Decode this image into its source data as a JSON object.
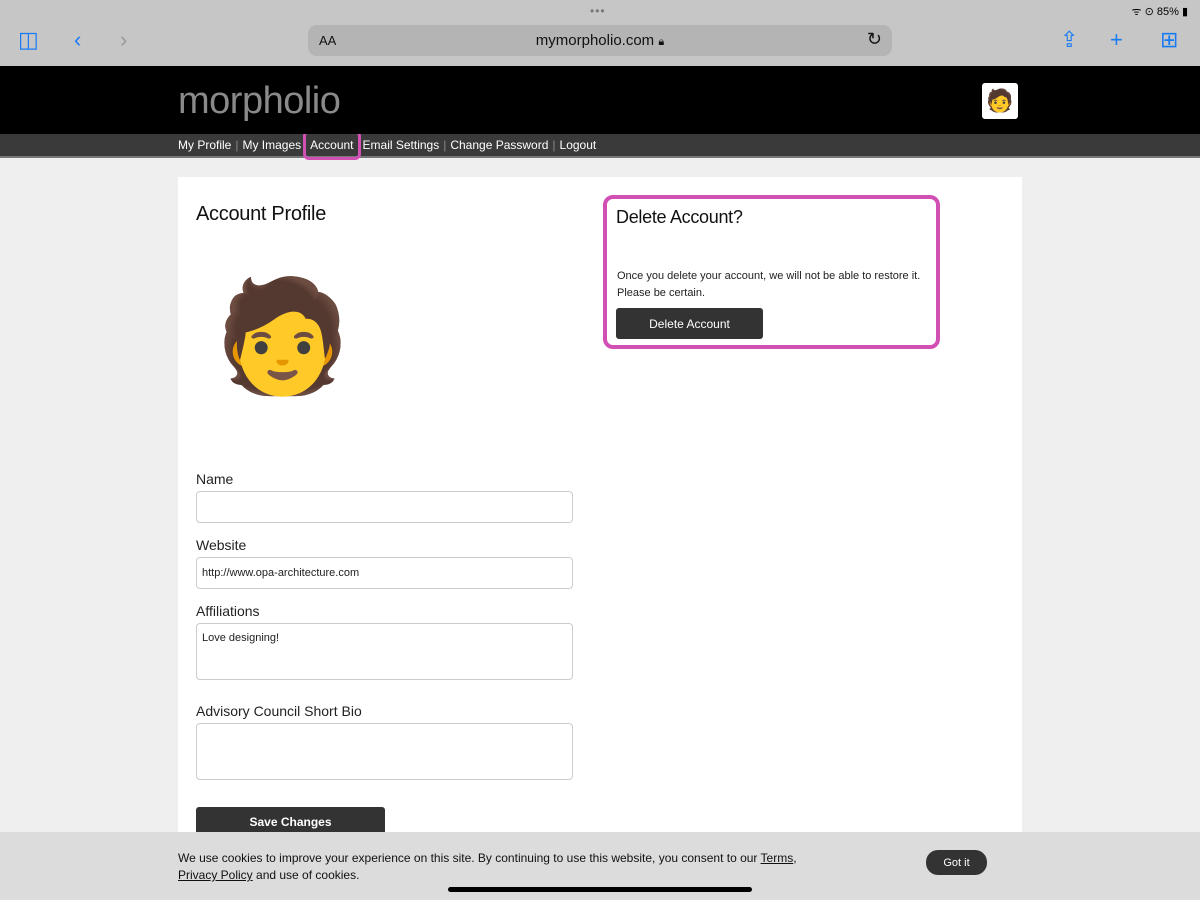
{
  "browser": {
    "url": "mymorpholio.com",
    "aa": "AA",
    "battery": "85%",
    "wifi": "wifi-icon"
  },
  "site": {
    "logo": "morpholio",
    "nav": [
      "My Profile",
      "My Images",
      "Account",
      "Email Settings",
      "Change Password",
      "Logout"
    ],
    "active_nav": "Account",
    "highlight_color": "#d24fb4"
  },
  "profile": {
    "title": "Account Profile",
    "name_label": "Name",
    "name_value": "",
    "website_label": "Website",
    "website_value": "http://www.opa-architecture.com",
    "affiliations_label": "Affiliations",
    "affiliations_value": "Love designing!",
    "bio_label": "Advisory Council Short Bio",
    "bio_value": "",
    "save_label": "Save Changes"
  },
  "delete": {
    "title": "Delete Account?",
    "line1": "Once you delete your account, we will not be able to restore it.",
    "line2": "Please be certain.",
    "button": "Delete Account"
  },
  "cookie": {
    "text1": "We use cookies to improve your experience on this site. By continuing to use this website, you consent to our ",
    "terms": "Terms",
    "comma": ",",
    "privacy": "Privacy Policy",
    "text2": " and use of cookies.",
    "button": "Got it"
  }
}
